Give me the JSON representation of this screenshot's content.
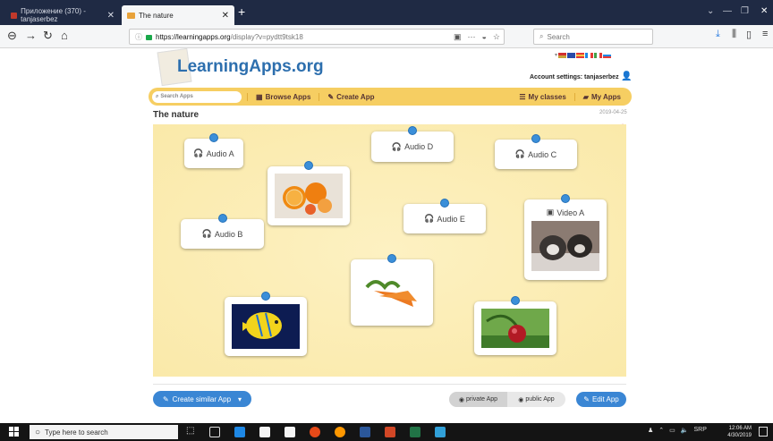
{
  "browser": {
    "tabs": [
      {
        "label": "Приложение (370) - tanjaserbez",
        "active": false
      },
      {
        "label": "The nature",
        "active": true
      }
    ],
    "new_tab": "+",
    "url_host": "https://learningapps.org",
    "url_path": "/display?v=pydtt9tsk18",
    "search_placeholder": "Search",
    "more_dots": "···"
  },
  "site": {
    "logo": "LearningApps.org",
    "account_label": "Account settings: tanjaserbez",
    "search_placeholder": "Search Apps",
    "nav": {
      "browse": "Browse Apps",
      "create": "Create App",
      "classes": "My classes",
      "myapps": "My Apps"
    },
    "flag_colors": [
      "#d32f2f",
      "#2b4aa8",
      "#c9a13a",
      "#e53935",
      "#1e88e5",
      "#43a047",
      "#e0e0e0"
    ]
  },
  "app": {
    "title": "The nature",
    "date": "2019-04-25",
    "cards": [
      {
        "label": "Audio A"
      },
      {
        "label": "Audio D"
      },
      {
        "label": "Audio C"
      },
      {
        "label": "Audio E"
      },
      {
        "label": "Audio B"
      },
      {
        "label": "Video A"
      }
    ]
  },
  "actions": {
    "create_similar": "Create similar App",
    "private": "private App",
    "public": "public App",
    "edit": "Edit App"
  },
  "taskbar": {
    "search_placeholder": "Type here to search",
    "lang": "SRP",
    "time": "12:06 AM",
    "date": "4/30/2019"
  },
  "colors": {
    "accent": "#3a86d4",
    "nav_bar": "#f6ce62",
    "board": "#fbecb4",
    "pin": "#3b8fd9"
  }
}
